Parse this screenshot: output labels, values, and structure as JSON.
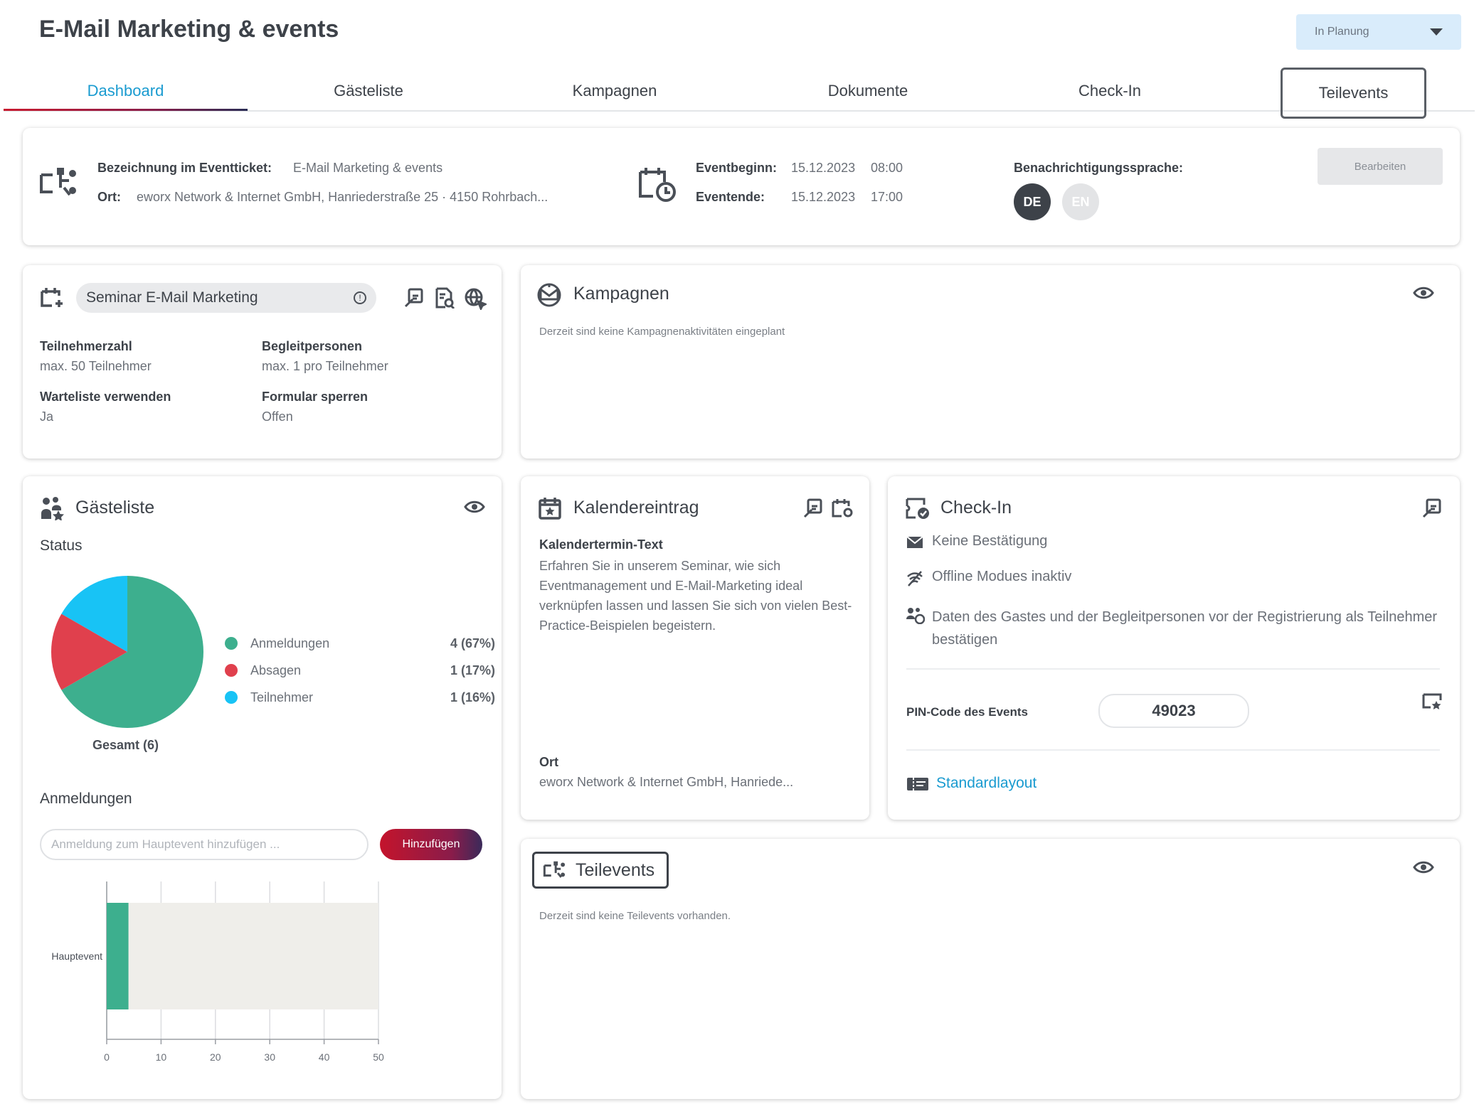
{
  "header": {
    "title": "E-Mail Marketing & events",
    "status_value": "In Planung"
  },
  "tabs": [
    {
      "label": "Dashboard",
      "active": true
    },
    {
      "label": "Gästeliste"
    },
    {
      "label": "Kampagnen"
    },
    {
      "label": "Dokumente"
    },
    {
      "label": "Check-In"
    },
    {
      "label": "Teilevents"
    }
  ],
  "event_info": {
    "ticket_label": "Bezeichnung im Eventticket:",
    "ticket_value": "E-Mail Marketing & events",
    "location_label": "Ort:",
    "location_value": "eworx Network & Internet GmbH, Hanriederstraße 25 · 4150 Rohrbach...",
    "start_label": "Eventbeginn:",
    "start_date": "15.12.2023",
    "start_time": "08:00",
    "end_label": "Eventende:",
    "end_date": "15.12.2023",
    "end_time": "17:00",
    "language_label": "Benachrichtigungssprache:",
    "lang_de": "DE",
    "lang_en": "EN",
    "edit_button": "Bearbeiten"
  },
  "seminar": {
    "name": "Seminar E-Mail Marketing",
    "participants_label": "Teilnehmerzahl",
    "participants_value": "max. 50 Teilnehmer",
    "companions_label": "Begleitpersonen",
    "companions_value": "max. 1 pro Teilnehmer",
    "waitlist_label": "Warteliste verwenden",
    "waitlist_value": "Ja",
    "lock_label": "Formular sperren",
    "lock_value": "Offen"
  },
  "campaigns": {
    "title": "Kampagnen",
    "empty_text": "Derzeit sind keine Kampagnenaktivitäten eingeplant"
  },
  "guestlist": {
    "title": "Gästeliste",
    "status_label": "Status",
    "total_label": "Gesamt (6)",
    "registrations_title": "Anmeldungen",
    "input_placeholder": "Anmeldung zum Hauptevent hinzufügen ...",
    "add_button": "Hinzufügen",
    "legend": [
      {
        "name": "Anmeldungen",
        "value": "4 (67%)",
        "color": "#3daf8e"
      },
      {
        "name": "Absagen",
        "value": "1 (17%)",
        "color": "#e0404d"
      },
      {
        "name": "Teilnehmer",
        "value": "1 (16%)",
        "color": "#18c3f5"
      }
    ]
  },
  "calendar": {
    "title": "Kalendereintrag",
    "text_label": "Kalendertermin-Text",
    "text_value": "Erfahren Sie in unserem Seminar, wie sich Eventmanagement und E-Mail-Marketing ideal verknüpfen lassen und lassen Sie sich von vielen Best-Practice-Beispielen begeistern.",
    "location_label": "Ort",
    "location_value": "eworx Network & Internet GmbH, Hanriede..."
  },
  "checkin": {
    "title": "Check-In",
    "item1": "Keine Bestätigung",
    "item2": "Offline Modues inaktiv",
    "item3": "Daten des Gastes und der Begleitpersonen vor der Registrierung als Teilnehmer bestätigen",
    "pin_label": "PIN-Code des Events",
    "pin_value": "49023",
    "layout_link": "Standardlayout"
  },
  "subevents": {
    "title": "Teilevents",
    "empty_text": "Derzeit sind keine Teilevents vorhanden."
  },
  "chart_data": [
    {
      "type": "pie",
      "categories": [
        "Anmeldungen",
        "Absagen",
        "Teilnehmer"
      ],
      "values": [
        4,
        1,
        1
      ],
      "colors": [
        "#3daf8e",
        "#e0404d",
        "#18c3f5"
      ],
      "title": "Status"
    },
    {
      "type": "bar",
      "orientation": "horizontal",
      "categories": [
        "Hauptevent"
      ],
      "values": [
        4
      ],
      "capacity": 50,
      "xlim": [
        0,
        50
      ],
      "xticks": [
        0,
        10,
        20,
        30,
        40,
        50
      ],
      "color": "#3daf8e",
      "background_color": "#efeeea",
      "grid": true
    }
  ]
}
